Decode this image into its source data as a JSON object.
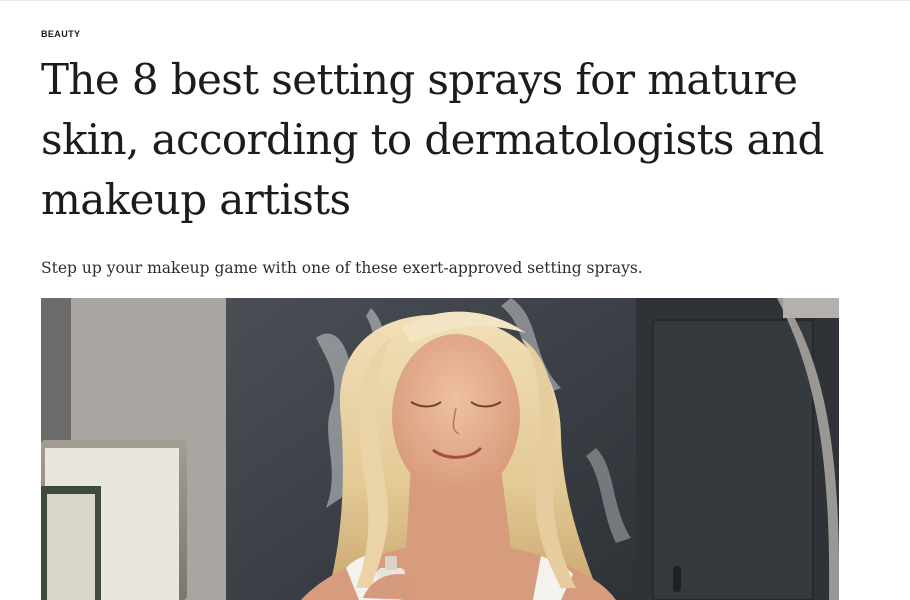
{
  "article": {
    "category": "BEAUTY",
    "headline": "The 8 best setting sprays for mature skin, according to dermatologists and makeup artists",
    "dek": "Step up your makeup game with one of these exert-approved setting sprays."
  },
  "colors": {
    "text": "#1c1c1c",
    "dek": "#2d2d2d",
    "background": "#ffffff"
  },
  "hero_image": {
    "subject": "woman with closed eyes applying setting spray"
  }
}
